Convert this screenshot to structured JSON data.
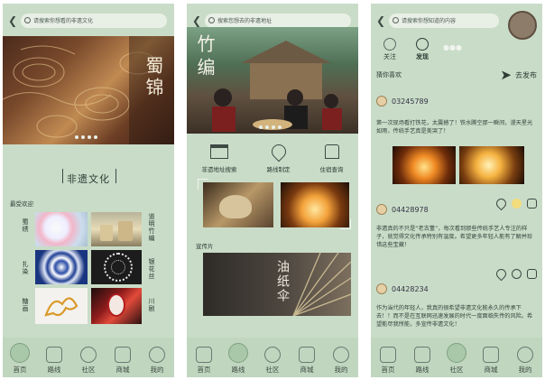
{
  "screens": [
    {
      "search_placeholder": "请搜索你想看的非遗文化",
      "hero_text": "蜀锦",
      "section_title": "非遗文化",
      "subsection": "最受欢迎",
      "items": [
        {
          "name": "蜀绣"
        },
        {
          "name": "道明竹编"
        },
        {
          "name": "扎染"
        },
        {
          "name": "银花丝"
        },
        {
          "name": "糖画"
        },
        {
          "name": "川剧"
        }
      ],
      "tabs": [
        "首页",
        "路线",
        "社区",
        "商城",
        "我的"
      ],
      "active_tab": 0
    },
    {
      "search_placeholder": "搜索您想去的非遗地址",
      "hero_text": "竹编",
      "shortcuts": [
        "非遗地址搜索",
        "路线制定",
        "住宿查询"
      ],
      "subsection": "宣传片",
      "video_title": "油纸伞",
      "tabs": [
        "首页",
        "路线",
        "社区",
        "商城",
        "我的"
      ],
      "active_tab": 1
    },
    {
      "search_placeholder": "请搜索你想知道的内容",
      "tabs_top": [
        "关注",
        "发现"
      ],
      "recommend_label": "猜你喜欢",
      "publish_label": "去发布",
      "posts": [
        {
          "user": "03245789",
          "text": "第一次现场看打铁花，太震撼了！铁水腾空那一瞬间，漫天星光如雨，传统手艺真是美哭了！"
        },
        {
          "user": "04428978",
          "text": "非遗真的不只是“老古董”，每次看到那些传统手艺人专注的样子，就觉得文化传承特别有温度。希望更多年轻人能有了解并珍惜这些宝藏！"
        },
        {
          "user": "04428234",
          "text": "作为当代的年轻人，我真的很希望非遗文化能永久的传承下去！！而不是在互联网迅速发展的时代一度面临失传的风险。希望能尽我所能，多宣传非遗文化！"
        }
      ],
      "tabs": [
        "首页",
        "路线",
        "社区",
        "商城",
        "我的"
      ],
      "active_tab": 2
    }
  ]
}
